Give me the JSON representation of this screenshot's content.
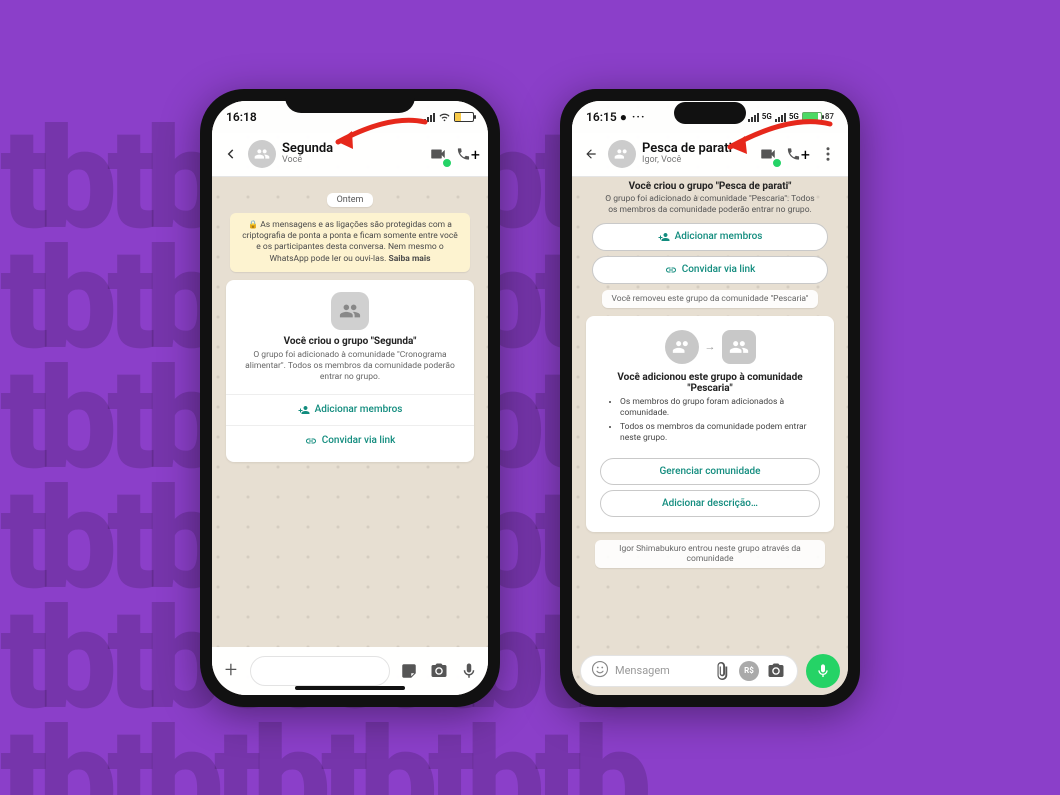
{
  "colors": {
    "accent": "#128c7e",
    "whatsapp_green": "#25d366",
    "bg_purple": "#8b3fc9",
    "arrow_red": "#e6281b"
  },
  "phoneA": {
    "statusbar": {
      "time": "16:18",
      "wifi": "wifi-icon",
      "signal": "signal-icon",
      "battery_pct": 35
    },
    "header": {
      "group_name": "Segunda",
      "subtitle": "Você",
      "videocall_label": "video-call",
      "call_label": "voice-call-add"
    },
    "chat": {
      "date_pill": "Ontem",
      "encryption_msg": "As mensagens e as ligações são protegidas com a criptografia de ponta a ponta e ficam somente entre você e os participantes desta conversa. Nem mesmo o WhatsApp pode ler ou ouvi-las.",
      "encryption_more": "Saiba mais",
      "card": {
        "headline": "Você criou o grupo \"Segunda\"",
        "body": "O grupo foi adicionado à comunidade \"Cronograma alimentar\". Todos os membros da comunidade poderão entrar no grupo.",
        "add_members": "Adicionar membros",
        "invite_link": "Convidar via link"
      }
    },
    "inputbar": {
      "plus": "+",
      "sticker": "sticker-icon",
      "camera": "camera-icon",
      "mic": "mic-icon"
    }
  },
  "phoneB": {
    "statusbar": {
      "time": "16:15",
      "indicators": "● ···",
      "net": "5G",
      "net2": "5G",
      "battery_pct": 87,
      "battery_label": "87"
    },
    "header": {
      "group_name": "Pesca de parati",
      "subtitle": "Igor, Você",
      "videocall_label": "video-call",
      "call_label": "voice-call-add",
      "more": "more-options"
    },
    "chat": {
      "card1": {
        "headline": "Você criou o grupo \"Pesca de parati\"",
        "body": "O grupo foi adicionado à comunidade \"Pescaria\". Todos os membros da comunidade poderão entrar no grupo.",
        "add_members": "Adicionar membros",
        "invite_link": "Convidar via link"
      },
      "removed_msg": "Você removeu este grupo da comunidade \"Pescaria\"",
      "card2": {
        "headline": "Você adicionou este grupo à comunidade \"Pescaria\"",
        "bullets": [
          "Os membros do grupo foram adicionados à comunidade.",
          "Todos os membros da comunidade podem entrar neste grupo."
        ],
        "manage": "Gerenciar comunidade",
        "add_desc": "Adicionar descrição…"
      },
      "join_msg": "Igor Shimabukuro entrou neste grupo através da comunidade"
    },
    "inputbar": {
      "emoji": "emoji-icon",
      "placeholder": "Mensagem",
      "attach": "attach-icon",
      "rs": "R$",
      "camera": "camera-icon",
      "mic": "mic-icon"
    }
  }
}
